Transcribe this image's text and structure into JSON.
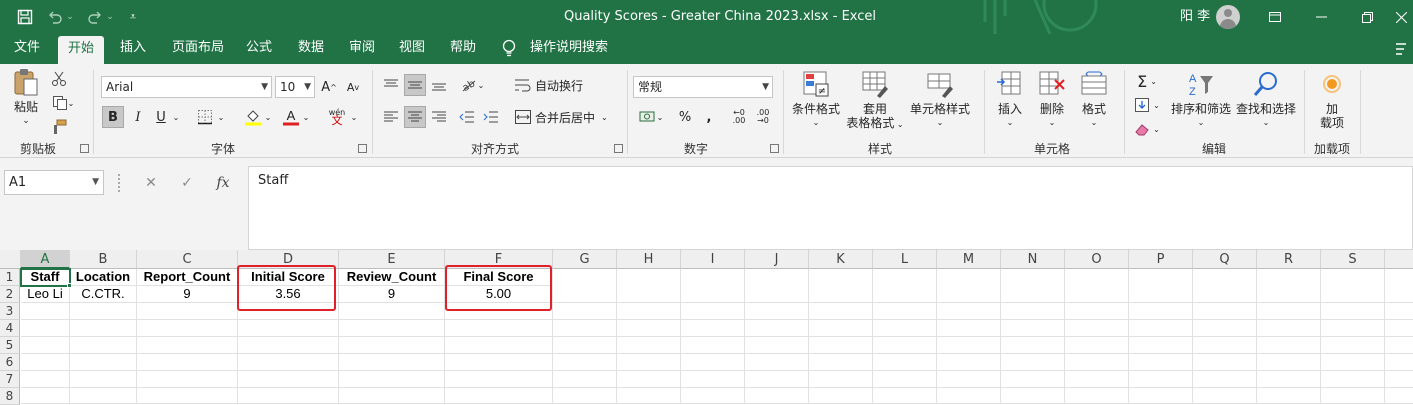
{
  "titlebar": {
    "title": "Quality Scores - Greater China 2023.xlsx  -  Excel",
    "user": "阳 李"
  },
  "tabs": [
    "文件",
    "开始",
    "插入",
    "页面布局",
    "公式",
    "数据",
    "审阅",
    "视图",
    "帮助"
  ],
  "tell_me": "操作说明搜索",
  "ribbon": {
    "clipboard": {
      "paste": "粘贴",
      "label": "剪贴板"
    },
    "font": {
      "name": "Arial",
      "size": "10",
      "bold": "B",
      "italic": "I",
      "underline": "U",
      "label": "字体",
      "wen": "wén",
      "A": "A"
    },
    "alignment": {
      "wrap": "自动换行",
      "merge": "合并后居中",
      "label": "对齐方式"
    },
    "number": {
      "format": "常规",
      "label": "数字",
      "percent": "%",
      "comma": ","
    },
    "styles": {
      "conditional": "条件格式",
      "table_line1": "套用",
      "table_line2": "表格格式",
      "cell_styles": "单元格样式",
      "label": "样式"
    },
    "cells": {
      "insert": "插入",
      "delete": "删除",
      "format": "格式",
      "label": "单元格"
    },
    "editing": {
      "sort": "排序和筛选",
      "find": "查找和选择",
      "label": "编辑"
    },
    "addins": {
      "line1": "加",
      "line2": "载项",
      "label": "加载项"
    }
  },
  "formula_bar": {
    "name_box": "A1",
    "content": "Staff",
    "fx": "fx"
  },
  "sheet": {
    "columns": [
      "A",
      "B",
      "C",
      "D",
      "E",
      "F",
      "G",
      "H",
      "I",
      "J",
      "K",
      "L",
      "M",
      "N",
      "O",
      "P",
      "Q",
      "R",
      "S"
    ],
    "rows": [
      "1",
      "2",
      "3",
      "4",
      "5",
      "6",
      "7",
      "8"
    ],
    "headers": [
      "Staff",
      "Location",
      "Report_Count",
      "Initial Score",
      "Review_Count",
      "Final Score"
    ],
    "row2": [
      "Leo Li",
      "C.CTR.",
      "9",
      "3.56",
      "9",
      "5.00"
    ]
  }
}
